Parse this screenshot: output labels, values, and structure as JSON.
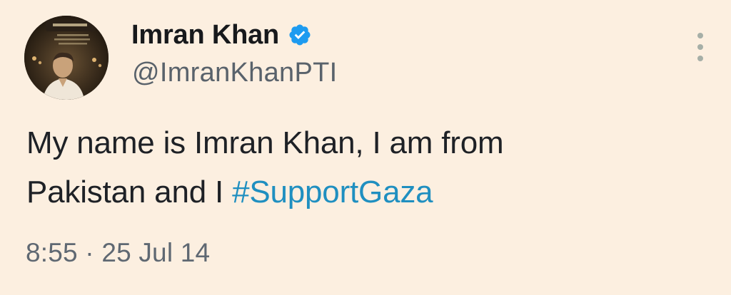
{
  "author": {
    "display_name": "Imran Khan",
    "handle": "@ImranKhanPTI",
    "verified_icon": "verified-badge-icon",
    "avatar_icon": "profile-avatar"
  },
  "tweet": {
    "text_part1": "My name is Imran Khan, I am from",
    "text_part2": "Pakistan and I ",
    "hashtag": "#SupportGaza"
  },
  "meta": {
    "time": "8:55",
    "separator": " · ",
    "date": "25 Jul 14"
  },
  "menu": {
    "icon": "more-options-icon"
  },
  "colors": {
    "background": "#fcefe0",
    "hashtag": "#1f8fc0",
    "verified": "#1d9bf0",
    "secondary_text": "#59626b"
  }
}
